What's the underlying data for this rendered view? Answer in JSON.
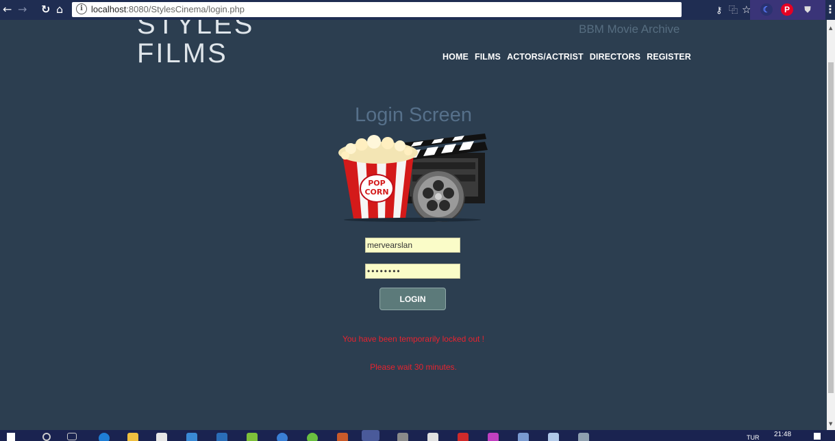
{
  "browser": {
    "url_host": "localhost",
    "url_rest": ":8080/StylesCinema/login.php"
  },
  "site": {
    "logo_line1": "STYLES",
    "logo_line2": "FILMS",
    "tagline": "BBM Movie Archive",
    "nav": [
      "HOME",
      "FILMS",
      "ACTORS/ACTRIST",
      "DIRECTORS",
      "REGISTER"
    ]
  },
  "login": {
    "title": "Login Screen",
    "username_value": "mervearslan",
    "password_value": "••••••••",
    "button_label": "LOGIN",
    "error_line1": "You have been temporarily locked out !",
    "error_line2": "Please wait 30 minutes."
  },
  "taskbar": {
    "clock": "21:48",
    "day": "TUR"
  },
  "colors": {
    "page_bg": "#2c3e50",
    "error": "#e8232f",
    "input_bg": "#fafcc8",
    "button": "#5c7a7a"
  }
}
